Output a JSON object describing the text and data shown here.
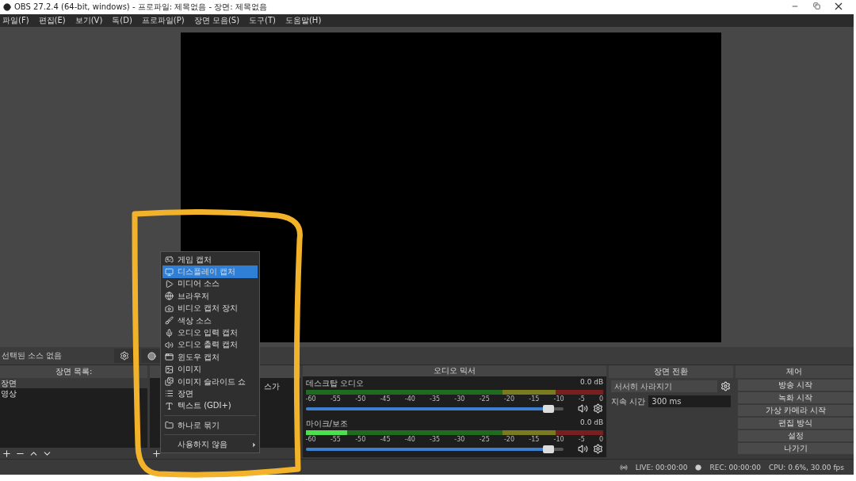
{
  "window": {
    "title": "OBS 27.2.4 (64-bit, windows) - 프로파일: 제목없음 - 장면: 제목없음"
  },
  "menu": [
    "파일(F)",
    "편집(E)",
    "보기(V)",
    "독(D)",
    "프로파일(P)",
    "장면 모음(S)",
    "도구(T)",
    "도움말(H)"
  ],
  "source_bar": {
    "label": "선택된 소스 없음"
  },
  "scenes": {
    "title": "장면 목록:",
    "items": [
      {
        "label": "장면",
        "selected": true
      },
      {
        "label": "영상",
        "selected": false
      }
    ]
  },
  "sources": {
    "fragment": "스가"
  },
  "mixer": {
    "title": "오디오 믹서",
    "channels": [
      {
        "name": "데스크탑 오디오",
        "reading": "0.0 dB",
        "level": 0,
        "scale": [
          "-60",
          "-55",
          "-50",
          "-45",
          "-40",
          "-35",
          "-30",
          "-25",
          "-20",
          "-15",
          "-10",
          "-5",
          "0"
        ],
        "volume": {
          "level": 0.95
        }
      },
      {
        "name": "마이크/보조",
        "reading": "0.0 dB",
        "level": 0.14,
        "scale": [
          "-60",
          "-55",
          "-50",
          "-45",
          "-40",
          "-35",
          "-30",
          "-25",
          "-20",
          "-15",
          "-10",
          "-5",
          "0"
        ],
        "volume": {
          "level": 0.95
        }
      }
    ]
  },
  "transitions": {
    "title": "장면 전환",
    "transition": "서서히 사라지기",
    "duration_label": "지속 시간",
    "duration": "300 ms"
  },
  "controls": {
    "title": "제어",
    "buttons": [
      "방송 시작",
      "녹화 시작",
      "가상 카메라 시작",
      "편집 방식",
      "설정",
      "나가기"
    ]
  },
  "status": {
    "live": "LIVE: 00:00:00",
    "rec": "REC: 00:00:00",
    "cpu": "CPU: 0.6%, 30.00 fps"
  },
  "context_menu": [
    {
      "kind": "item",
      "label": "게임 캡처",
      "selected": false
    },
    {
      "kind": "item",
      "label": "디스플레이 캡처",
      "selected": true
    },
    {
      "kind": "item",
      "label": "미디어 소스",
      "selected": false
    },
    {
      "kind": "item",
      "label": "브라우저",
      "selected": false
    },
    {
      "kind": "item",
      "label": "비디오 캡처 장치",
      "selected": false
    },
    {
      "kind": "item",
      "label": "색상 소스",
      "selected": false
    },
    {
      "kind": "item",
      "label": "오디오 입력 캡처",
      "selected": false
    },
    {
      "kind": "item",
      "label": "오디오 출력 캡처",
      "selected": false
    },
    {
      "kind": "item",
      "label": "윈도우 캡처",
      "selected": false
    },
    {
      "kind": "item",
      "label": "이미지",
      "selected": false
    },
    {
      "kind": "item",
      "label": "이미지 슬라이드 쇼",
      "selected": false
    },
    {
      "kind": "item",
      "label": "장면",
      "selected": false
    },
    {
      "kind": "item",
      "label": "텍스트 (GDI+)",
      "selected": false
    },
    {
      "kind": "separator"
    },
    {
      "kind": "item",
      "label": "하나로 묶기",
      "selected": false
    },
    {
      "kind": "separator"
    },
    {
      "kind": "submenu",
      "label": "사용하지 않음",
      "selected": false
    }
  ]
}
